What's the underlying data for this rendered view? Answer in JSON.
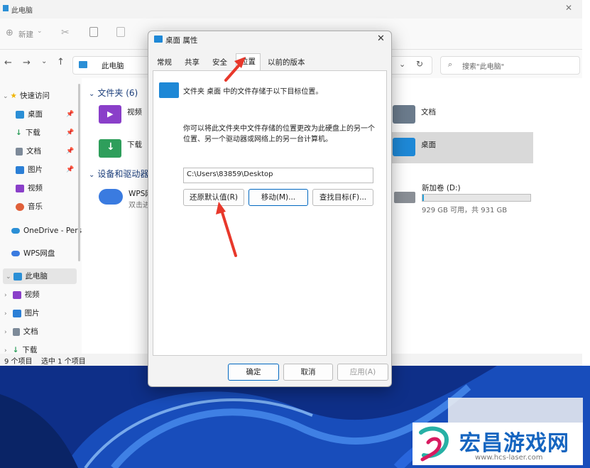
{
  "explorer": {
    "title": "此电脑",
    "toolbar": {
      "new_label": "新建"
    },
    "address": {
      "text": "此电脑",
      "search_placeholder": "搜索\"此电脑\""
    },
    "nav": {
      "quick_access": "快速访问",
      "quick_items": [
        {
          "label": "桌面",
          "color": "#2b8fd6"
        },
        {
          "label": "下载",
          "color": "#2e9e5b"
        },
        {
          "label": "文档",
          "color": "#7d8a99"
        },
        {
          "label": "图片",
          "color": "#2b7fd6"
        },
        {
          "label": "视频",
          "color": "#8a3fc9"
        },
        {
          "label": "音乐",
          "color": "#e0603a"
        }
      ],
      "onedrive": "OneDrive - Pers",
      "wps": "WPS网盘",
      "this_pc": "此电脑",
      "pc_items": [
        "视频",
        "图片",
        "文档",
        "下载"
      ]
    },
    "content": {
      "folders_header": "文件夹 (6)",
      "folders": [
        {
          "name": "视频"
        },
        {
          "name": "文档"
        },
        {
          "name": "下载"
        },
        {
          "name": "桌面"
        }
      ],
      "devices_header": "设备和驱动器",
      "wps_name": "WPS网",
      "wps_sub": "双击进",
      "drive_name": "新加卷 (D:)",
      "drive_space": "929 GB 可用，共 931 GB",
      "drive_used_fraction": 0.002
    },
    "status": {
      "count": "9 个项目",
      "selected": "选中 1 个项目"
    }
  },
  "dialog": {
    "title": "桌面 属性",
    "tabs": [
      "常规",
      "共享",
      "安全",
      "位置",
      "以前的版本"
    ],
    "active_tab": "位置",
    "info_text": "文件夹 桌面 中的文件存储于以下目标位置。",
    "desc_line1": "你可以将此文件夹中文件存储的位置更改为此硬盘上的另一个",
    "desc_line2": "位置、另一个驱动器或网络上的另一台计算机。",
    "path_value": "C:\\Users\\83859\\Desktop",
    "restore_label": "还原默认值(R)",
    "move_label": "移动(M)...",
    "find_label": "查找目标(F)...",
    "ok_label": "确定",
    "cancel_label": "取消",
    "apply_label": "应用(A)"
  },
  "watermark": {
    "brand": "宏昌游戏网",
    "url": "www.hcs-laser.com"
  },
  "colors": {
    "accent": "#0067c0",
    "arrow_red": "#e8382b",
    "wallpaper": "#0e2f88",
    "brand_blue": "#1565c0"
  }
}
